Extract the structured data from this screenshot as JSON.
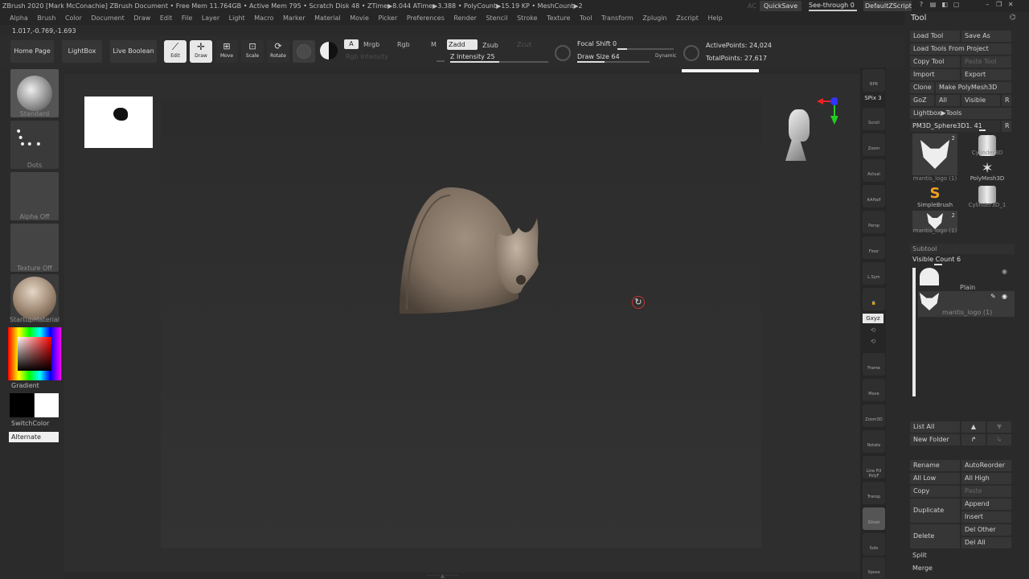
{
  "titlebar": {
    "text": "ZBrush 2020 [Mark McConachie]  ZBrush Document    • Free Mem 11.764GB • Active Mem 795 • Scratch Disk 48 • ZTime▶8.044 ATime▶3.388 • PolyCount▶15.19 KP • MeshCount▶2",
    "ac": "AC",
    "quicksave": "QuickSave",
    "see_through": "See-through  0",
    "script": "DefaultZScript"
  },
  "menu": [
    "Alpha",
    "Brush",
    "Color",
    "Document",
    "Draw",
    "Edit",
    "File",
    "Layer",
    "Light",
    "Macro",
    "Marker",
    "Material",
    "Movie",
    "Picker",
    "Preferences",
    "Render",
    "Stencil",
    "Stroke",
    "Texture",
    "Tool",
    "Transform",
    "Zplugin",
    "Zscript",
    "Help"
  ],
  "coords": "1.017,-0.769,-1.693",
  "topbar": {
    "home": "Home Page",
    "lightbox": "LightBox",
    "live_boolean": "Live Boolean",
    "edit": "Edit",
    "draw": "Draw",
    "move": "Move",
    "scale": "Scale",
    "rotate": "Rotate",
    "a": "A",
    "mrgb": "Mrgb",
    "rgb": "Rgb",
    "m": "M",
    "zadd": "Zadd",
    "zsub": "Zsub",
    "zcut": "Zcut",
    "rgb_intensity": "Rgb Intensity",
    "z_intensity": "Z Intensity 25",
    "focal_shift": "Focal Shift 0",
    "draw_size": "Draw Size 64",
    "dynamic": "Dynamic",
    "active_points": "ActivePoints: 24,024",
    "total_points": "TotalPoints: 27,617"
  },
  "left": {
    "standard": "Standard",
    "dots": "Dots",
    "alpha_off": "Alpha Off",
    "texture_off": "Texture Off",
    "material": "StartupMaterial",
    "gradient": "Gradient",
    "switchcolor": "SwitchColor",
    "alternate": "Alternate"
  },
  "right_tools": [
    {
      "name": "bpr",
      "label": "BPR"
    },
    {
      "name": "spix",
      "label": "SPix 3"
    },
    {
      "name": "scroll",
      "label": "Scroll"
    },
    {
      "name": "zoom",
      "label": "Zoom"
    },
    {
      "name": "actual",
      "label": "Actual"
    },
    {
      "name": "aahalf",
      "label": "AAHalf"
    },
    {
      "name": "persp",
      "label": "Persp"
    },
    {
      "name": "floor",
      "label": "Floor"
    },
    {
      "name": "lsym",
      "label": "L.Sym"
    },
    {
      "name": "xyz",
      "label": "Gxyz"
    },
    {
      "name": "frame",
      "label": "Frame"
    },
    {
      "name": "move",
      "label": "Move"
    },
    {
      "name": "zoom3d",
      "label": "Zoom3D"
    },
    {
      "name": "rotate",
      "label": "Rotate"
    },
    {
      "name": "linefill",
      "label": "Line Fill PolyF"
    },
    {
      "name": "transp",
      "label": "Transp"
    },
    {
      "name": "ghost",
      "label": "Ghost"
    },
    {
      "name": "solo",
      "label": "Solo"
    },
    {
      "name": "xpose",
      "label": "Xpose"
    }
  ],
  "panel": {
    "title": "Tool",
    "load_tool": "Load Tool",
    "save_as": "Save As",
    "load_project": "Load Tools From Project",
    "copy_tool": "Copy Tool",
    "paste_tool": "Paste Tool",
    "import": "Import",
    "export": "Export",
    "clone": "Clone",
    "make_polymesh": "Make PolyMesh3D",
    "goz": "GoZ",
    "all": "All",
    "visible": "Visible",
    "r": "R",
    "lightbox_tools": "Lightbox▶Tools",
    "current_tool": "PM3D_Sphere3D1. 41",
    "tools": [
      {
        "label": "mantis_logo (1)",
        "badge": "2"
      },
      {
        "label": "Cylinder3D",
        "badge": ""
      },
      {
        "label": "PolyMesh3D",
        "badge": ""
      },
      {
        "label": "SimpleBrush",
        "badge": ""
      },
      {
        "label": "Cylinder3D_1",
        "badge": ""
      },
      {
        "label": "mantis_logo (1)",
        "badge": "2"
      }
    ],
    "subtool": "Subtool",
    "visible_count": "Visible Count 6",
    "subtool_items": [
      {
        "label": "Plain"
      },
      {
        "label": "mantis_logo (1)"
      }
    ],
    "list_all": "List All",
    "new_folder": "New Folder",
    "rename": "Rename",
    "autoreorder": "AutoReorder",
    "all_low": "All Low",
    "all_high": "All High",
    "copy": "Copy",
    "paste": "Paste",
    "duplicate": "Duplicate",
    "append": "Append",
    "insert": "Insert",
    "delete": "Delete",
    "del_other": "Del Other",
    "del_all": "Del All",
    "split": "Split",
    "merge": "Merge"
  }
}
